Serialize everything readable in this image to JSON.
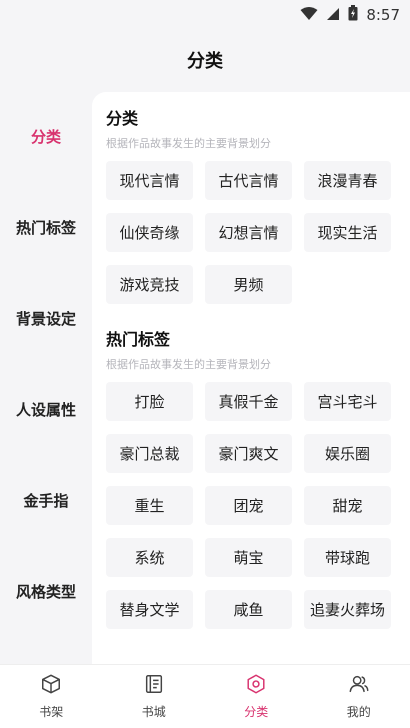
{
  "status": {
    "time": "8:57"
  },
  "header": {
    "title": "分类"
  },
  "sidebar": {
    "items": [
      {
        "label": "分类",
        "active": true
      },
      {
        "label": "热门标签",
        "active": false
      },
      {
        "label": "背景设定",
        "active": false
      },
      {
        "label": "人设属性",
        "active": false
      },
      {
        "label": "金手指",
        "active": false
      },
      {
        "label": "风格类型",
        "active": false
      }
    ]
  },
  "sections": [
    {
      "title": "分类",
      "desc": "根据作品故事发生的主要背景划分",
      "tags": [
        "现代言情",
        "古代言情",
        "浪漫青春",
        "仙侠奇缘",
        "幻想言情",
        "现实生活",
        "游戏竞技",
        "男频"
      ]
    },
    {
      "title": "热门标签",
      "desc": "根据作品故事发生的主要背景划分",
      "tags": [
        "打脸",
        "真假千金",
        "宫斗宅斗",
        "豪门总裁",
        "豪门爽文",
        "娱乐圈",
        "重生",
        "团宠",
        "甜宠",
        "系统",
        "萌宝",
        "带球跑",
        "替身文学",
        "咸鱼",
        "追妻火葬场"
      ]
    }
  ],
  "tabbar": {
    "items": [
      {
        "label": "书架",
        "icon": "cube-icon",
        "active": false
      },
      {
        "label": "书城",
        "icon": "book-icon",
        "active": false
      },
      {
        "label": "分类",
        "icon": "hexagon-icon",
        "active": true
      },
      {
        "label": "我的",
        "icon": "user-icon",
        "active": false
      }
    ]
  },
  "colors": {
    "accent": "#d8326e",
    "tag_bg": "#f5f5f7",
    "page_bg": "#f5f5f7"
  }
}
